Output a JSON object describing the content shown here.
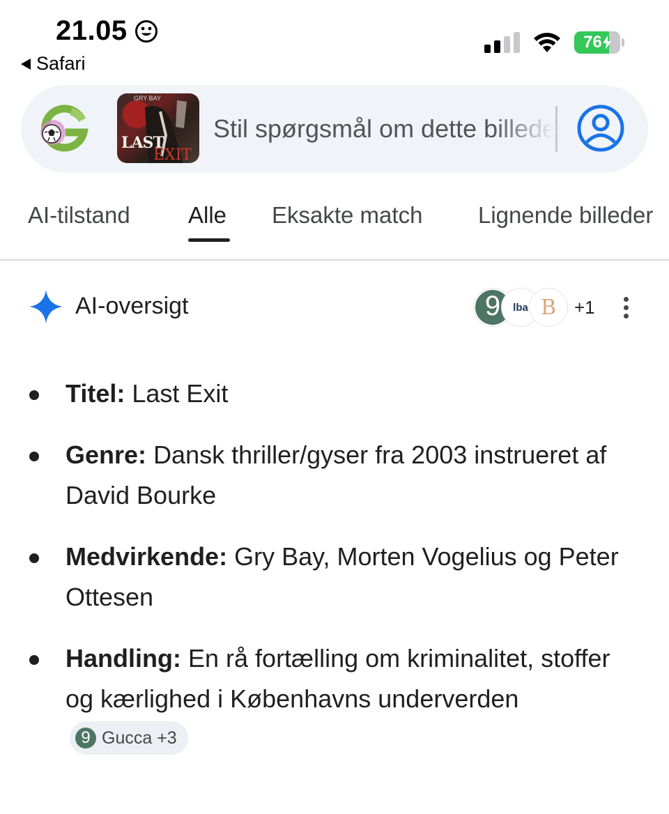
{
  "status_bar": {
    "time": "21.05",
    "back_app": "Safari",
    "battery": "76",
    "battery_level": 0.76,
    "colors": {
      "battery_fill": "#34c759"
    }
  },
  "search": {
    "placeholder": "Stil spørgsmål om dette billede",
    "logo_icon": "google-lens-logo",
    "thumbnail": {
      "title": "LAST",
      "subtitle": "EXIT"
    },
    "account_icon": "account-circle-icon"
  },
  "tabs": [
    {
      "label": "AI-tilstand",
      "active": false
    },
    {
      "label": "Alle",
      "active": true
    },
    {
      "label": "Eksakte match",
      "active": false
    },
    {
      "label": "Lignende billeder",
      "active": false
    }
  ],
  "ai_overview": {
    "title": "AI-oversigt",
    "icon": "sparkle-icon",
    "sources": [
      {
        "label": "9"
      },
      {
        "label": "lba"
      },
      {
        "label": "B"
      }
    ],
    "sources_more": "+1",
    "colors": {
      "sparkle": "#1a73e8",
      "source_green": "#4d7563"
    },
    "bullets": [
      {
        "label": "Titel:",
        "text": "Last Exit"
      },
      {
        "label": "Genre:",
        "text": "Dansk thriller/gyser fra 2003 instrueret af David Bourke"
      },
      {
        "label": "Medvirkende:",
        "text": "Gry Bay, Morten Vogelius og Peter Ottesen"
      },
      {
        "label": "Handling:",
        "text": "En rå fortælling om kriminalitet, stoffer og kærlighed i Københavns underverden",
        "chip": {
          "icon": "9",
          "label": "Gucca +3"
        }
      }
    ]
  }
}
